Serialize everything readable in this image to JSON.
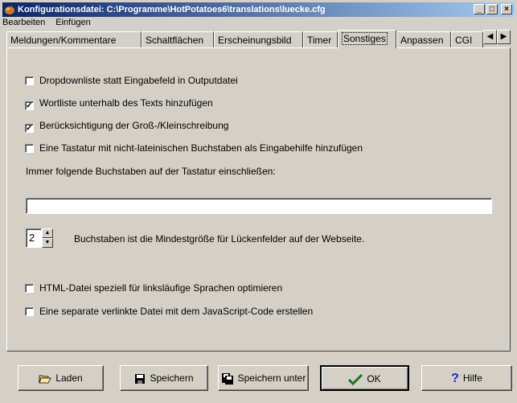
{
  "window": {
    "title": "Konfigurationsdatei: C:\\Programme\\HotPotatoes6\\translations\\luecke.cfg",
    "controls": [
      "_",
      "□",
      "×"
    ]
  },
  "menu": [
    "Bearbeiten",
    "Einfügen"
  ],
  "tabs": [
    "Meldungen/Kommentare",
    "Schaltflächen",
    "Erscheinungsbild",
    "Timer",
    "Sonstiges",
    "Anpassen",
    "CGI"
  ],
  "active_tab": "Sonstiges",
  "options": {
    "dropdown": {
      "label": "Dropdownliste statt Eingabefeld in Outputdatei",
      "checked": false
    },
    "wordlist": {
      "label": "Wortliste unterhalb des Texts hinzufügen",
      "checked": true
    },
    "case": {
      "label": "Berücksichtigung der Groß-/Kleinschreibung",
      "checked": true
    },
    "keyboard": {
      "label": "Eine Tastatur mit nicht-lateinischen Buchstaben als Eingabehilfe hinzufügen",
      "checked": false
    },
    "include_label": "Immer folgende Buchstaben auf der Tastatur einschließen:",
    "include_value": "",
    "min_size_value": "2",
    "min_size_label": "Buchstaben ist die Mindestgröße für Lückenfelder auf der Webseite.",
    "rtl": {
      "label": "HTML-Datei speziell für linksläufige Sprachen optimieren",
      "checked": false
    },
    "separate_js": {
      "label": "Eine separate verlinkte Datei mit dem JavaScript-Code erstellen",
      "checked": false
    }
  },
  "buttons": {
    "load": "Laden",
    "save": "Speichern",
    "save_as": "Speichern unter",
    "ok": "OK",
    "help": "Hilfe"
  }
}
